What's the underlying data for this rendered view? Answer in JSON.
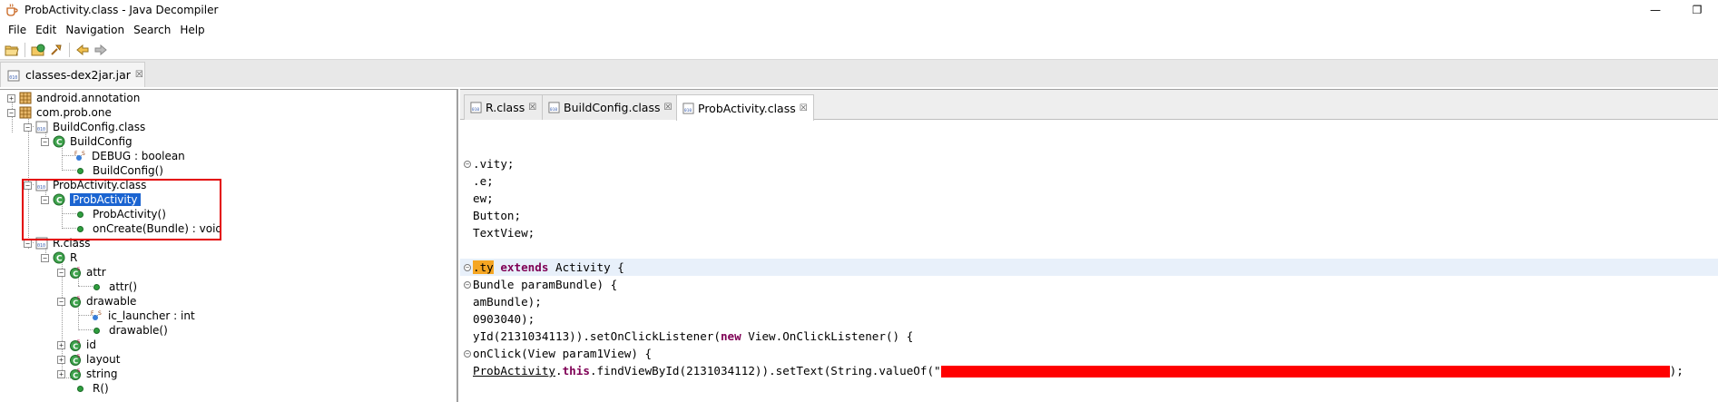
{
  "window": {
    "title": "ProbActivity.class - Java Decompiler",
    "controls": {
      "minimize": "—",
      "restore": "❐"
    }
  },
  "menu": [
    "File",
    "Edit",
    "Navigation",
    "Search",
    "Help"
  ],
  "toolbar": {
    "icons": [
      "open-file-icon",
      "open-type-icon",
      "search-icon",
      "back-arrow-icon",
      "forward-arrow-icon"
    ]
  },
  "jar_tab": {
    "label": "classes-dex2jar.jar",
    "close": "☒"
  },
  "tree": [
    {
      "label": "android.annotation"
    },
    {
      "label": "com.prob.one"
    },
    {
      "label": "BuildConfig.class"
    },
    {
      "label": "BuildConfig"
    },
    {
      "label": "DEBUG : boolean"
    },
    {
      "label": "BuildConfig()"
    },
    {
      "label": "ProbActivity.class"
    },
    {
      "label": "ProbActivity"
    },
    {
      "label": "ProbActivity()"
    },
    {
      "label": "onCreate(Bundle) : void"
    },
    {
      "label": "R.class"
    },
    {
      "label": "R"
    },
    {
      "label": "attr"
    },
    {
      "label": "attr()"
    },
    {
      "label": "drawable"
    },
    {
      "label": "ic_launcher : int"
    },
    {
      "label": "drawable()"
    },
    {
      "label": "id"
    },
    {
      "label": "layout"
    },
    {
      "label": "string"
    },
    {
      "label": "R()"
    }
  ],
  "editor_tabs": [
    {
      "label": "R.class"
    },
    {
      "label": "BuildConfig.class"
    },
    {
      "label": "ProbActivity.class"
    }
  ],
  "code": {
    "l1": ".vity;",
    "l2": ".e;",
    "l3": "ew;",
    "l4": "Button;",
    "l5": "TextView;",
    "l6_hl": ".ty",
    "l6_kw": "extends",
    "l6_rest": " Activity {",
    "l7": "Bundle paramBundle) {",
    "l8": "amBundle);",
    "l9": "0903040);",
    "l10_a": "yId(2131034113)).setOnClickListener(",
    "l10_kw": "new",
    "l10_b": " View.OnClickListener() {",
    "l11": "onClick(View param1View) {",
    "l12_ref": "ProbActivity",
    "l12_dot": ".",
    "l12_kw": "this",
    "l12_b": ".findViewById(2131034112)).setText(String.valueOf(\"",
    "l12_end": ");"
  }
}
